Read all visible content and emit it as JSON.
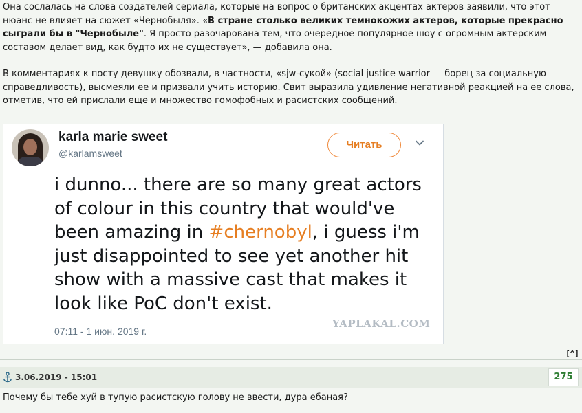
{
  "article": {
    "p1_a": "Она сослалась на слова создателей сериала, которые на вопрос о британских акцентах актеров заявили, что этот нюанс не влияет на сюжет «Чернобыля». «",
    "p1_bold": "В стране столько великих темнокожих актеров, которые прекрасно сыграли бы в \"Чернобыле\"",
    "p1_b": ". Я просто разочарована тем, что очередное популярное шоу с огромным актерским составом делает вид, как будто их не существует», — добавила она.",
    "p2": "В комментариях к посту девушку обозвали, в частности, «sjw-сукой» (social justice warrior — борец за социальную справедливость), высмеяли ее и призвали учить историю. Свит выразила удивление негативной реакцией на ее слова, отметив, что ей прислали еще и множество гомофобных и расистских сообщений."
  },
  "tweet": {
    "name": "karla marie sweet",
    "handle": "@karlamsweet",
    "follow_label": "Читать",
    "text_a": "i dunno... there are so many great actors of colour in this country that would've been amazing in ",
    "hashtag": "#chernobyl",
    "text_b": ", i guess i'm just disappointed to see yet another hit show with a massive cast that makes it look like PoC don't exist.",
    "timestamp": "07:11 - 1 июн. 2019 г.",
    "watermark": "YAPLAKAL.COM",
    "accent_color": "#e67e22"
  },
  "nav": {
    "up_label": "[^]"
  },
  "comment": {
    "date": "3.06.2019 - 15:01",
    "score": "275",
    "text": "Почему бы тебе хуй в тупую расистскую голову не ввести, дура ебаная?"
  },
  "icons": [
    "anchor-icon",
    "chevron-down-icon",
    "avatar"
  ]
}
